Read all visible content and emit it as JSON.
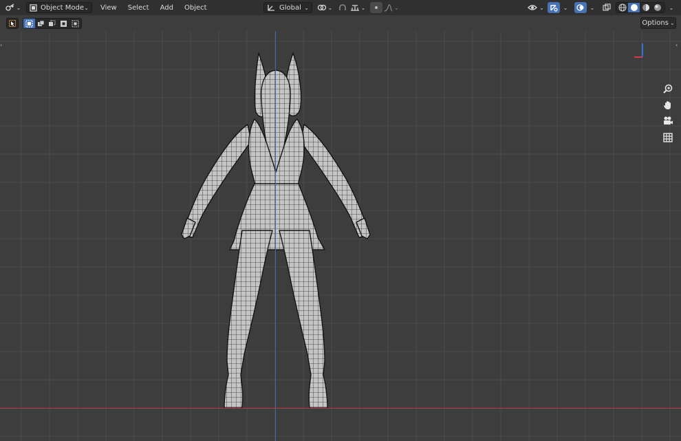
{
  "header": {
    "mode_label": "Object Mode",
    "menus": [
      "View",
      "Select",
      "Add",
      "Object"
    ],
    "transform_orientation": "Global",
    "icons": {
      "editor_type": "editor-type-icon",
      "mode": "object-mode-icon",
      "orientation": "transform-orientation-icon",
      "pivot": "transform-pivot-icon",
      "snap": "snap-icon",
      "snap_target": "snap-increment-icon",
      "proportional": "proportional-edit-icon",
      "falloff": "falloff-curve-icon",
      "visibility": "object-visibility-icon",
      "gizmo": "gizmo-icon",
      "overlay": "overlay-icon",
      "xray": "xray-icon",
      "wireframe": "wireframe-shading-icon",
      "solid": "solid-shading-icon",
      "material": "material-preview-icon",
      "rendered": "rendered-shading-icon"
    }
  },
  "tool_header": {
    "options_label": "Options",
    "select_modes": [
      "select-new-icon",
      "select-extend-icon",
      "select-subtract-icon",
      "select-invert-icon",
      "select-intersect-icon"
    ]
  },
  "navigation": [
    "zoom-icon",
    "pan-hand-icon",
    "camera-icon",
    "grid-ortho-icon"
  ],
  "colors": {
    "header_bg": "#303030",
    "viewport_bg": "#3d3d3d",
    "accent": "#4772b3",
    "x_axis": "#b9383f",
    "z_axis": "#3a6ea8"
  }
}
